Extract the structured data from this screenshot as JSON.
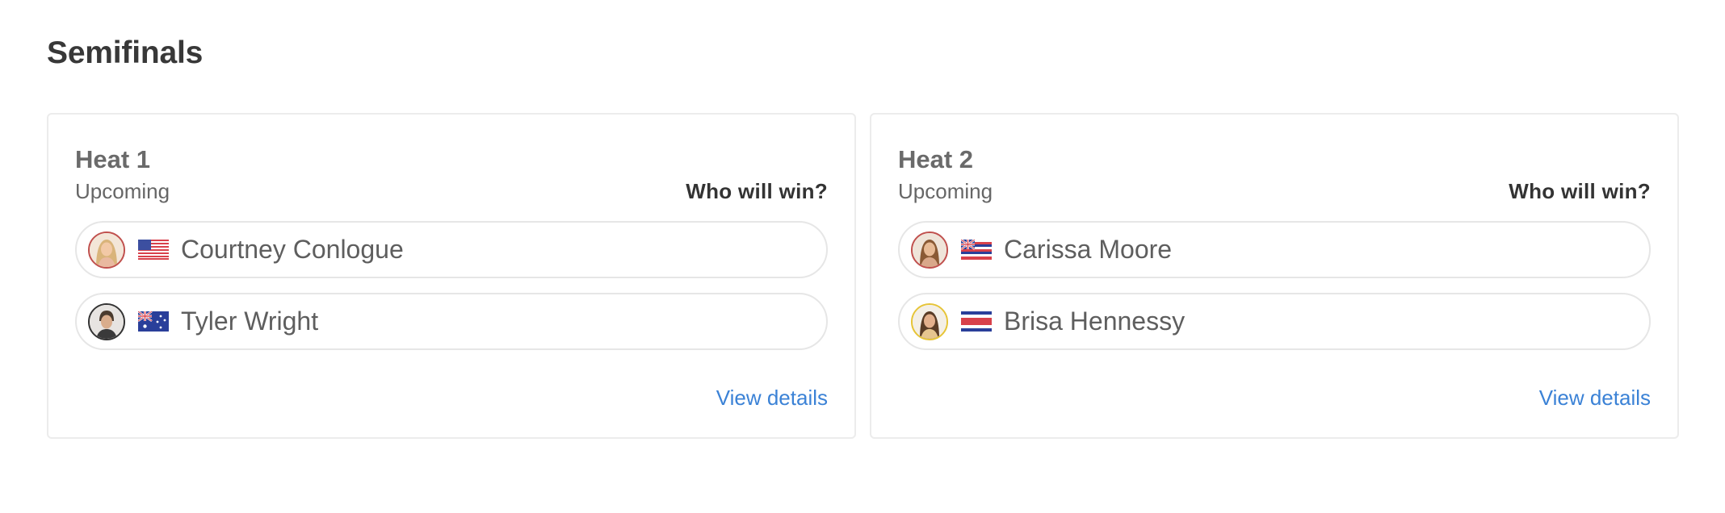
{
  "section": {
    "title": "Semifinals"
  },
  "heats": [
    {
      "name": "Heat 1",
      "status": "Upcoming",
      "prompt": "Who will win?",
      "details_label": "View details",
      "surfers": [
        {
          "name": "Courtney Conlogue",
          "flag": "usa-flag-icon",
          "avatar_ring_color": "#c0504d"
        },
        {
          "name": "Tyler Wright",
          "flag": "australia-flag-icon",
          "avatar_ring_color": "#333333"
        }
      ]
    },
    {
      "name": "Heat 2",
      "status": "Upcoming",
      "prompt": "Who will win?",
      "details_label": "View details",
      "surfers": [
        {
          "name": "Carissa Moore",
          "flag": "hawaii-flag-icon",
          "avatar_ring_color": "#c0504d"
        },
        {
          "name": "Brisa Hennessy",
          "flag": "costa-rica-flag-icon",
          "avatar_ring_color": "#e6c437"
        }
      ]
    }
  ],
  "colors": {
    "link": "#3b82d6",
    "card_border": "#ececec",
    "pill_border": "#e6e6e6"
  }
}
